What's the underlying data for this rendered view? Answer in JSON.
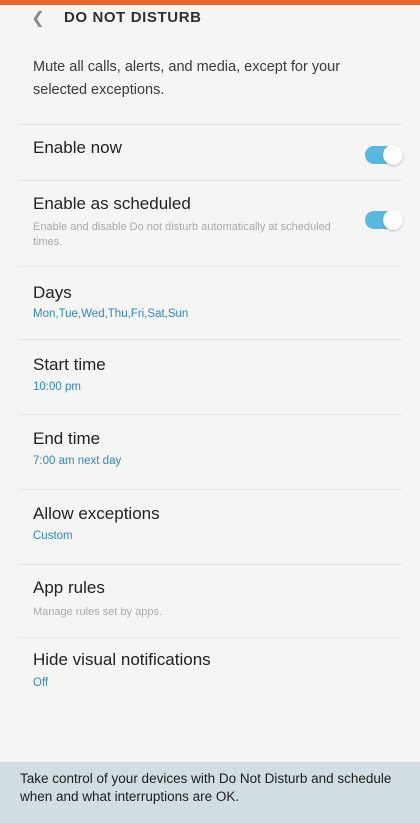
{
  "header": {
    "back_icon": "chevron-left-icon",
    "title": "DO NOT DISTURB",
    "accent_color": "#e8682f"
  },
  "intro": "Mute all calls, alerts, and media, except for your selected exceptions.",
  "settings": {
    "enable_now": {
      "title": "Enable now",
      "toggle_on": true
    },
    "enable_scheduled": {
      "title": "Enable as scheduled",
      "description": "Enable and disable Do not disturb automatically at scheduled times.",
      "toggle_on": true
    },
    "days": {
      "title": "Days",
      "value": "Mon,Tue,Wed,Thu,Fri,Sat,Sun"
    },
    "start_time": {
      "title": "Start time",
      "value": "10:00 pm"
    },
    "end_time": {
      "title": "End time",
      "value": "7:00 am next day"
    },
    "allow_exceptions": {
      "title": "Allow exceptions",
      "value": "Custom"
    },
    "app_rules": {
      "title": "App rules",
      "description": "Manage rules set by apps."
    },
    "hide_visual": {
      "title": "Hide visual notifications",
      "value": "Off"
    }
  },
  "colors": {
    "toggle_on": "#58b9de",
    "value_text": "#2f86c9",
    "caption_bg": "#d2dde3"
  },
  "caption": "Take control of your devices with Do Not Disturb and schedule when and what interruptions are OK."
}
